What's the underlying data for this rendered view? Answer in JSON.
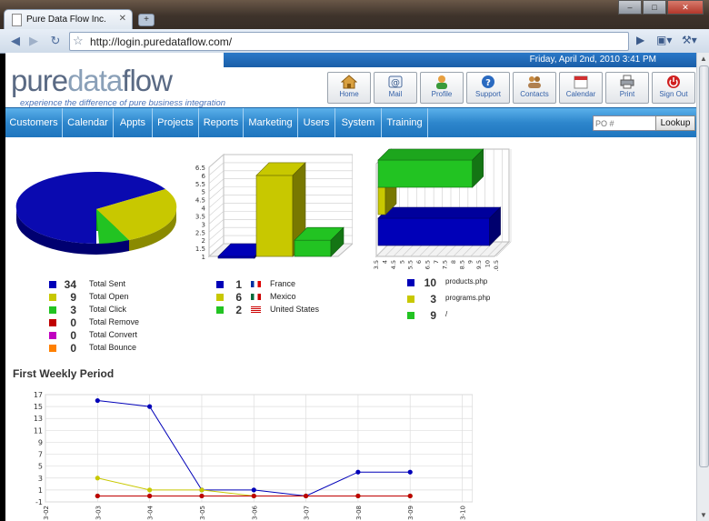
{
  "browser": {
    "tab_title": "Pure Data Flow Inc.",
    "tab_close": "✕",
    "new_tab": "+",
    "url": "http://login.puredataflow.com/",
    "window_buttons": [
      "–",
      "□",
      "✕"
    ]
  },
  "header": {
    "logo_pure": "pure",
    "logo_data": "data",
    "logo_flow": "flow",
    "tagline": "experience the difference of pure business integration",
    "datetime": "Friday, April 2nd, 2010  3:41 PM",
    "buttons": [
      {
        "label": "Home",
        "icon": "home-icon"
      },
      {
        "label": "Mail",
        "icon": "mail-icon"
      },
      {
        "label": "Profile",
        "icon": "profile-icon"
      },
      {
        "label": "Support",
        "icon": "support-icon"
      },
      {
        "label": "Contacts",
        "icon": "contacts-icon"
      },
      {
        "label": "Calendar",
        "icon": "calendar-icon"
      },
      {
        "label": "Print",
        "icon": "print-icon"
      },
      {
        "label": "Sign Out",
        "icon": "power-icon"
      }
    ]
  },
  "nav": {
    "items": [
      "Customers",
      "Calendar",
      "Appts",
      "Projects",
      "Reports",
      "Marketing",
      "Users",
      "System",
      "Training"
    ],
    "po_placeholder": "PO #",
    "lookup_label": "Lookup"
  },
  "colors": {
    "blue": "#0000b8",
    "olive": "#c8c800",
    "green": "#22c322",
    "red": "#c00000",
    "magenta": "#c000c0",
    "orange": "#ff8000"
  },
  "legend_email": [
    {
      "num": "34",
      "label": "Total Sent"
    },
    {
      "num": "9",
      "label": "Total Open"
    },
    {
      "num": "3",
      "label": "Total Click"
    },
    {
      "num": "0",
      "label": "Total Remove"
    },
    {
      "num": "0",
      "label": "Total Convert"
    },
    {
      "num": "0",
      "label": "Total Bounce"
    }
  ],
  "legend_country": [
    {
      "num": "1",
      "label": "France"
    },
    {
      "num": "6",
      "label": "Mexico"
    },
    {
      "num": "2",
      "label": "United States"
    }
  ],
  "legend_pages": [
    {
      "num": "10",
      "label": "products.php"
    },
    {
      "num": "3",
      "label": "programs.php"
    },
    {
      "num": "9",
      "label": "/"
    }
  ],
  "weekly_title": "First Weekly Period",
  "chart_data": [
    {
      "type": "pie",
      "labels": [
        "Total Sent",
        "Total Open",
        "Total Click",
        "Total Remove",
        "Total Convert",
        "Total Bounce"
      ],
      "values": [
        34,
        9,
        3,
        0,
        0,
        0
      ]
    },
    {
      "type": "bar",
      "categories": [
        "France",
        "Mexico",
        "United States"
      ],
      "values": [
        1,
        6,
        2
      ],
      "ylim": [
        1,
        6.5
      ],
      "yticks": [
        "1",
        "1.5",
        "2",
        "2.5",
        "3",
        "3.5",
        "4",
        "4.5",
        "5",
        "5.5",
        "6",
        "6.5"
      ]
    },
    {
      "type": "bar",
      "orientation": "horizontal",
      "categories": [
        "products.php",
        "programs.php",
        "/"
      ],
      "values": [
        10,
        3,
        9
      ],
      "xticks": [
        "3.5",
        "4",
        "4.5",
        "5",
        "5.5",
        "6",
        "6.5",
        "7",
        "7.5",
        "8",
        "8.5",
        "9",
        "9.5",
        "10",
        "10.5"
      ]
    },
    {
      "type": "line",
      "title": "First Weekly Period",
      "x": [
        "3-02",
        "3-03",
        "3-04",
        "3-05",
        "3-06",
        "3-07",
        "3-08",
        "3-09",
        "3-10"
      ],
      "yticks": [
        "-1",
        "1",
        "3",
        "5",
        "7",
        "9",
        "11",
        "13",
        "15",
        "17"
      ],
      "ylim": [
        -1,
        17
      ],
      "series": [
        {
          "color": "#0000b8",
          "values": [
            null,
            16,
            15,
            1,
            1,
            0,
            4,
            4,
            null
          ]
        },
        {
          "color": "#c8c800",
          "values": [
            null,
            3,
            1,
            1,
            0,
            0,
            0,
            0,
            null
          ]
        },
        {
          "color": "#22a022",
          "values": [
            null,
            0,
            0,
            0,
            0,
            0,
            0,
            0,
            null
          ]
        },
        {
          "color": "#c00000",
          "values": [
            null,
            0,
            0,
            0,
            0,
            0,
            0,
            0,
            null
          ]
        }
      ]
    }
  ]
}
